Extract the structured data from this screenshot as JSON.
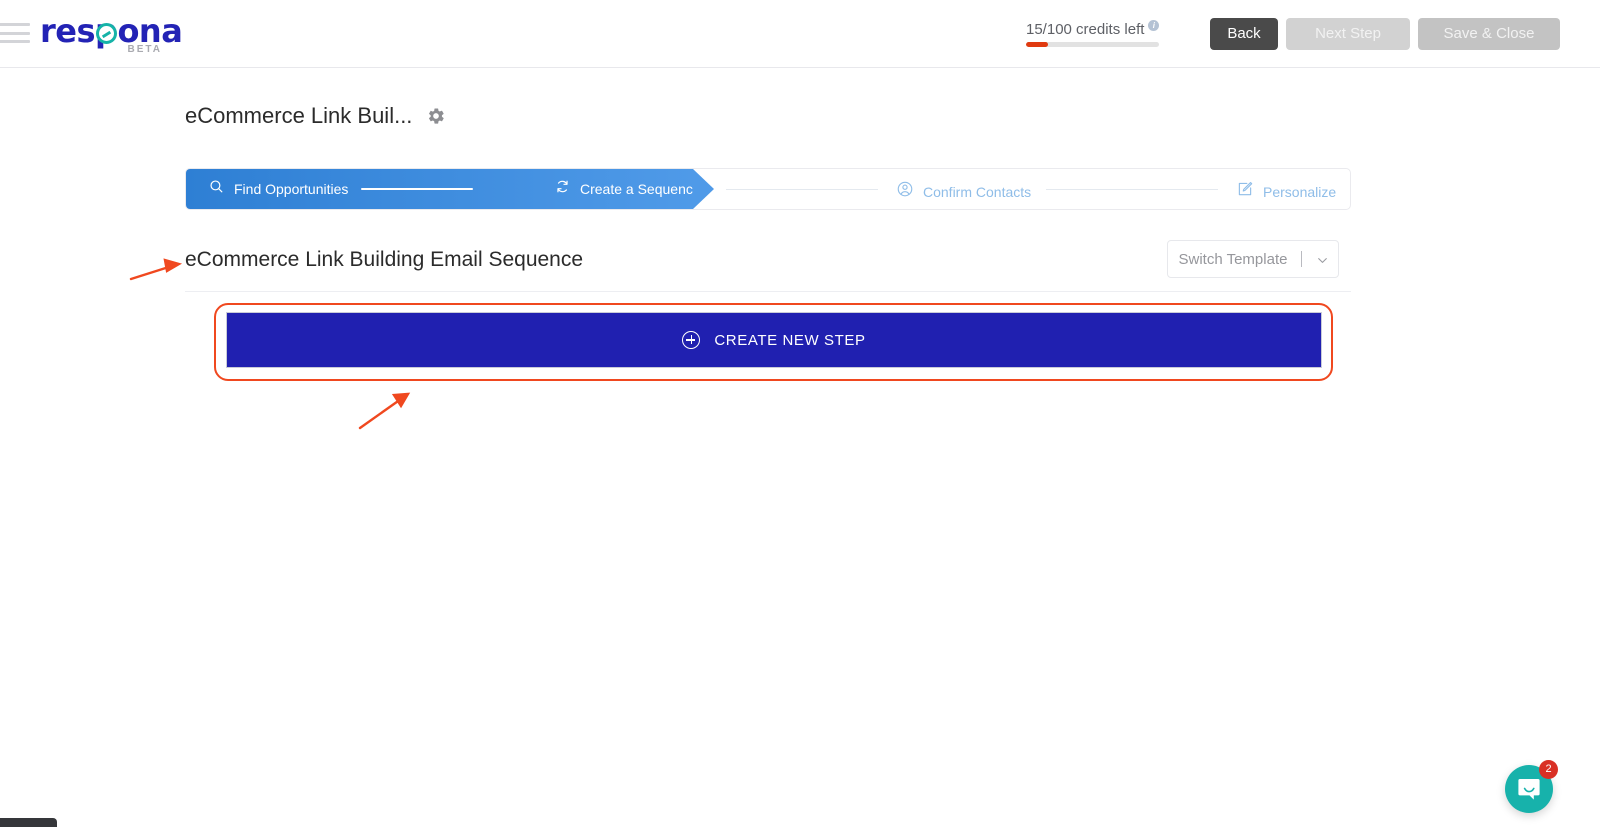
{
  "brand": {
    "logo_text": "respona",
    "logo_badge": "BETA",
    "logo_color": "#2323b5",
    "accent_color": "#16b3a8"
  },
  "topbar": {
    "menu_icon": "hamburger-menu-icon",
    "credits_text": "15/100 credits left",
    "credits_used": 15,
    "credits_total": 100,
    "credits_bar_color": "#e03a10",
    "info_icon": "info-icon",
    "info_glyph": "i",
    "buttons": {
      "back": "Back",
      "next_step": "Next Step",
      "save_close": "Save & Close"
    }
  },
  "page": {
    "title": "eCommerce Link Buil...",
    "settings_icon": "gear-icon"
  },
  "stepper": {
    "steps": [
      {
        "label": "Find Opportunities",
        "icon": "search-icon",
        "state": "active"
      },
      {
        "label": "Create a Sequence",
        "icon": "refresh-icon",
        "state": "active"
      },
      {
        "label": "Confirm Contacts",
        "icon": "user-circle-icon",
        "state": "inactive"
      },
      {
        "label": "Personalize",
        "icon": "edit-pencil-icon",
        "state": "inactive"
      }
    ],
    "active_color": "#4f9ae8",
    "inactive_color": "#8fbde8"
  },
  "sequence": {
    "title": "eCommerce Link Building Email Sequence",
    "switch_template_label": "Switch Template",
    "switch_template_icon": "chevron-down-icon",
    "create_step_label": "CREATE NEW STEP",
    "create_step_icon": "plus-circle-icon",
    "create_step_color": "#2020b0"
  },
  "annotations": {
    "highlight_color": "#f0481f",
    "arrow_to_title": "points to sequence title",
    "arrow_to_button": "points to create new step button",
    "box_around": "create new step button"
  },
  "chat": {
    "launcher_icon": "chat-bubble-icon",
    "unread_count": "2",
    "launcher_color": "#17b2ab",
    "badge_color": "#d93025"
  }
}
